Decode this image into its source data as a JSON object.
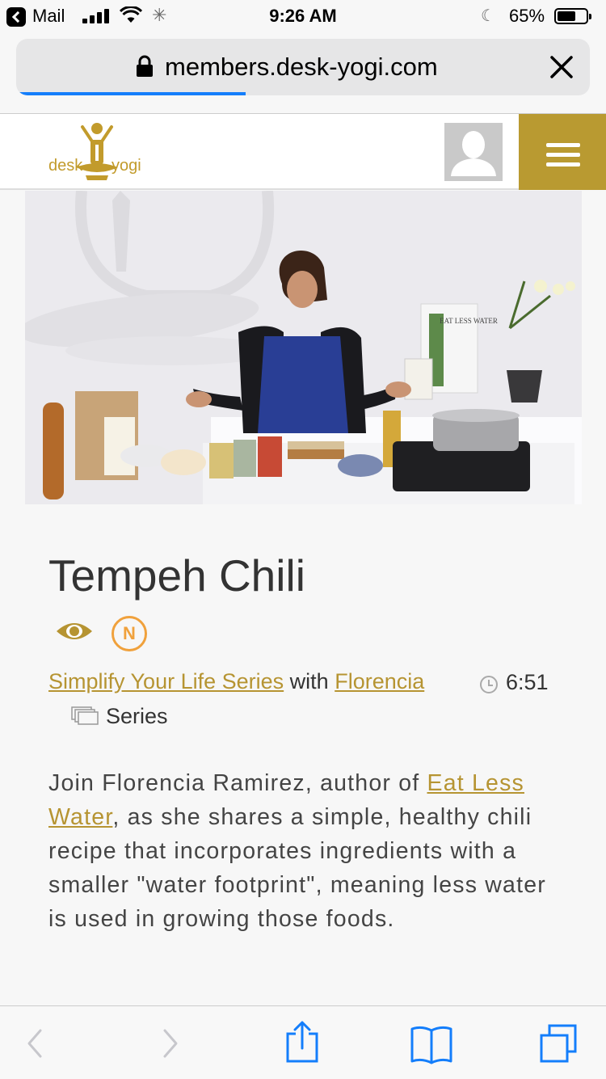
{
  "status_bar": {
    "back_app": "Mail",
    "time": "9:26 AM",
    "battery_percent": "65%",
    "battery_level": 0.65
  },
  "browser": {
    "url": "members.desk-yogi.com",
    "load_progress": 0.4
  },
  "header": {
    "logo_left": "desk",
    "logo_right": "yogi"
  },
  "video": {
    "book_cover_text": "EAT LESS WATER"
  },
  "content": {
    "title": "Tempeh Chili",
    "series_link": "Simplify Your Life Series",
    "with_text": "with",
    "instructor_link": "Florencia",
    "duration": "6:51",
    "type_label": "Series",
    "badge_letter": "N",
    "description_before": "Join Florencia Ramirez, author of ",
    "description_link": "Eat Less Water",
    "description_after": ", as she shares a simple, healthy chili recipe that incorporates ingredients with a smaller \"water footprint\", meaning less water is used in growing those foods."
  },
  "colors": {
    "brand_gold": "#b99a31",
    "link_gold": "#b69432",
    "badge_orange": "#f0a13c",
    "ios_blue": "#147efb"
  }
}
